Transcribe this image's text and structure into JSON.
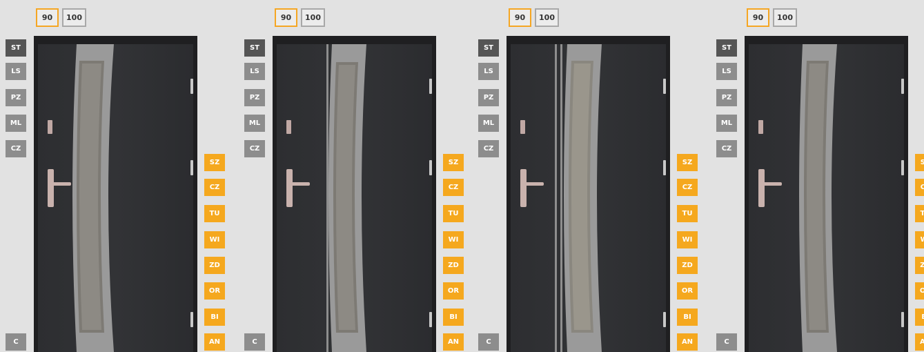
{
  "size_options": [
    "90",
    "100"
  ],
  "model_options": [
    "ST",
    "LS",
    "PZ",
    "ML",
    "CZ"
  ],
  "model_bottom": "C",
  "color_options": [
    "SZ",
    "CZ",
    "TU",
    "WI",
    "ZD",
    "OR",
    "BI",
    "AN"
  ],
  "colors": {
    "accent": "#f5a623",
    "model_inactive": "#8d8d8d",
    "model_active": "#555555",
    "door": "#323336",
    "background": "#e2e2e2"
  },
  "panels": [
    {
      "variant": "curved-glass-plain"
    },
    {
      "variant": "curved-glass-single-bar"
    },
    {
      "variant": "curved-glass-double-bar"
    },
    {
      "variant": "curved-glass-plain"
    }
  ]
}
